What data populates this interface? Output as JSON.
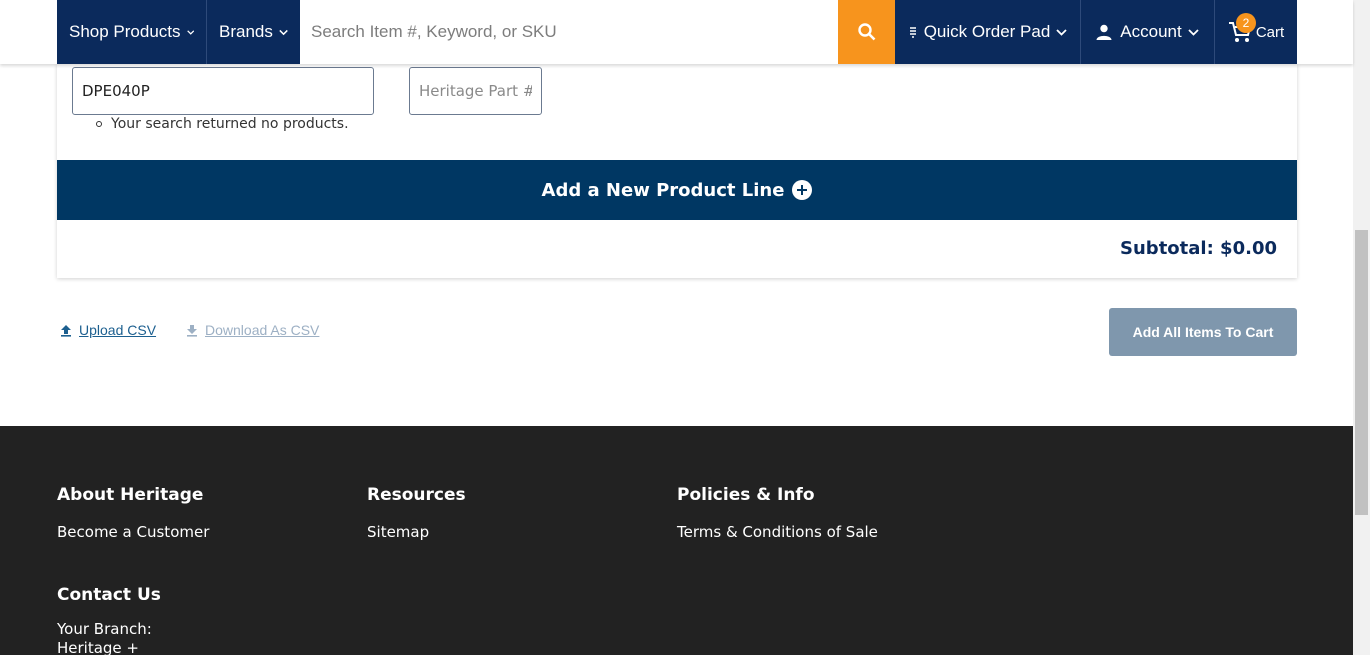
{
  "nav": {
    "shop_products": "Shop Products",
    "brands": "Brands",
    "search_placeholder": "Search Item #, Keyword, or SKU",
    "quick_order_pad": "Quick Order Pad",
    "account": "Account",
    "cart_label": "Cart",
    "cart_count": "2"
  },
  "order_line": {
    "item_value": "DPE040P",
    "part_placeholder": "Heritage Part #",
    "message": "Your search returned no products."
  },
  "add_line_label": "Add a New Product Line",
  "subtotal_label": "Subtotal: $0.00",
  "actions": {
    "upload_csv": "Upload CSV",
    "download_csv": "Download As CSV",
    "add_all": "Add All Items To Cart"
  },
  "footer": {
    "about_heading": "About Heritage",
    "about_link": "Become a Customer",
    "resources_heading": "Resources",
    "resources_link": "Sitemap",
    "policies_heading": "Policies & Info",
    "policies_link": "Terms & Conditions of Sale",
    "contact_heading": "Contact Us",
    "branch_label": "Your Branch:",
    "branch_name": "Heritage +"
  },
  "colors": {
    "nav_bg": "#0b2a5c",
    "accent_orange": "#f7941d",
    "add_line_bg": "#003763",
    "footer_bg": "#222222"
  }
}
